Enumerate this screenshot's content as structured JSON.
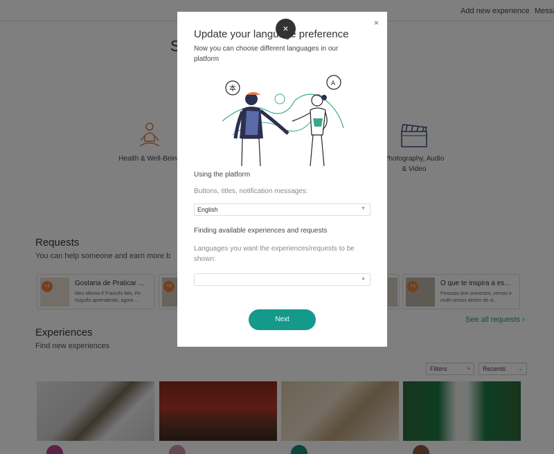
{
  "nav": {
    "add_experience": "Add new experience",
    "messages": "Messa"
  },
  "background": {
    "heading_start": "S",
    "heading_end": "s",
    "categories": [
      {
        "icon": "meditation-icon",
        "label": "Health & Well-Being"
      },
      {
        "icon": "clapperboard-icon",
        "label": "Photography, Audio & Video"
      }
    ],
    "requests": {
      "title": "Requests",
      "subtitle": "You can help someone and earn more b",
      "cards": [
        {
          "badge": "+1",
          "title": "Gostaria de Praticar ...",
          "desc": "Meu idioma é Francês falo, Po rtuguês aprendendo; agora ..."
        },
        {
          "badge": "+2",
          "title": "",
          "desc": ""
        },
        {
          "badge": "",
          "title": "",
          "desc": ""
        },
        {
          "badge": "+1",
          "title": "O que te inspira a es...",
          "desc": "Pessoas tem universos, versos e multi-versos dentro de si..."
        }
      ],
      "see_all": "See all requests"
    },
    "experiences": {
      "title": "Experiences",
      "subtitle": "Find new experiences",
      "filters_label": "Filters",
      "sort_label": "Recents"
    }
  },
  "modal": {
    "title": "Update your language preference",
    "subtitle": "Now you can choose different languages in our platform",
    "section1_title": "Using the platform",
    "section1_label": "Buttons, titles, notification messages:",
    "language_value": "English",
    "section2_title": "Finding available experiences and requests",
    "section2_label": "Languages you want the experiences/requests to be shown:",
    "experience_languages_value": "",
    "next_label": "Next",
    "close_glyph": "×",
    "floating_close_glyph": "×"
  },
  "colors": {
    "accent": "#14998a",
    "link": "#1a9c8c",
    "category_health": "#e0784a",
    "category_photo": "#3d4a7a"
  }
}
